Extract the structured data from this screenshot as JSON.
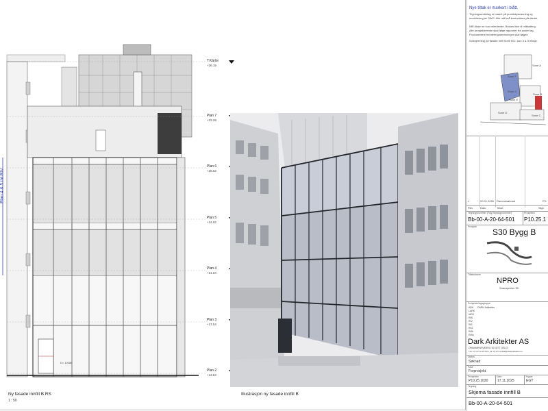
{
  "elevation": {
    "caption_title": "Ny fasade innfill B RS",
    "caption_scale": "1 : 50",
    "vertical_label": "Plan 4 & 5 iht RIV",
    "door_note": "D= 10286",
    "levels": [
      {
        "name": "T.Kärlor",
        "elev": "+36.19"
      },
      {
        "name": "Plan 7",
        "elev": "+32.29"
      },
      {
        "name": "Plan 6",
        "elev": "+28.62"
      },
      {
        "name": "Plan 5",
        "elev": "+24.92"
      },
      {
        "name": "Plan 4",
        "elev": "+21.24"
      },
      {
        "name": "Plan 3",
        "elev": "+17.54"
      },
      {
        "name": "Plan 2",
        "elev": "+13.84"
      }
    ]
  },
  "illustration": {
    "caption": "Illustrasjon ny fasade innfill B"
  },
  "title_block": {
    "notes_heading": "Nye tiltak er markert i blått.",
    "notes": [
      "Tegningsunderlag er basert på punktskyscanning og",
      "modellering av SWG. Alle mål må kontrolleres på stedet.",
      "",
      "NB! Akser er kun veiledende. Brukes ikke til målsetting.",
      "Alle prosjekterende skal følge rapporter fra andre fag.",
      "Produsenters monteringsanvisninger skal følges.",
      "",
      "Solskjerming på fasade infill Sone B/C: kun 4 & 5 etasje."
    ],
    "zones": [
      "Sone A",
      "Sone F",
      "Sone C",
      "Sone B",
      "Sone E",
      "Sone D",
      "Sone C"
    ],
    "revision": {
      "rev": "1",
      "date": "20.01.2026",
      "desc": "Rammesøknad",
      "sign": "PG"
    },
    "revision_headers": [
      "Rev.",
      "Dato",
      "Tekst",
      "Sign"
    ],
    "drawing_no_label": "Tegningsnummer (Fag/Tegningsnummer)",
    "drawing_no": "Bb-00-A-20-64-501",
    "project_no_label": "Prosjektnr",
    "project_no": "P10.25.1",
    "project_label": "Prosjekt",
    "project_name": "S30 Bygg B",
    "client_label": "Tiltakshaver",
    "client_name": "NPRO",
    "client_address": "Snarøyveien 30",
    "design_group_label": "Prosjekteringsgruppe",
    "design_group": [
      {
        "role": "ARK",
        "name": "DARK Arkitekter"
      },
      {
        "role": "LARK",
        "name": ""
      },
      {
        "role": "IARK",
        "name": ""
      },
      {
        "role": "RIB",
        "name": ""
      },
      {
        "role": "RIV",
        "name": ""
      },
      {
        "role": "RIE",
        "name": ""
      },
      {
        "role": "RIG",
        "name": ""
      },
      {
        "role": "RIBr",
        "name": ""
      },
      {
        "role": "RIAk",
        "name": ""
      }
    ],
    "firm_name": "Dark Arkitekter AS",
    "firm_address": "DRAMMENSVEIEN 130      0277 OSLO",
    "firm_contact": "TLF: 23 10 12 00    FAX: 23 10 12 01    dark@darkarkitekter.no",
    "status_label": "Status",
    "status": "Søknad",
    "phase_label": "Fase",
    "phase": "Forprosjekt",
    "proj_label": "Prosjektnr",
    "proj_value": "P10.25.1030",
    "date_label": "Dato",
    "date_value": "17.11.2025",
    "drawn_label": "Tegnet",
    "drawn_value": "EGY",
    "drawing_title_label": "Tegning",
    "drawing_title": "Skjema fasade innfill B",
    "drawing_no_bottom": "Bb-00-A-20-64-501"
  }
}
